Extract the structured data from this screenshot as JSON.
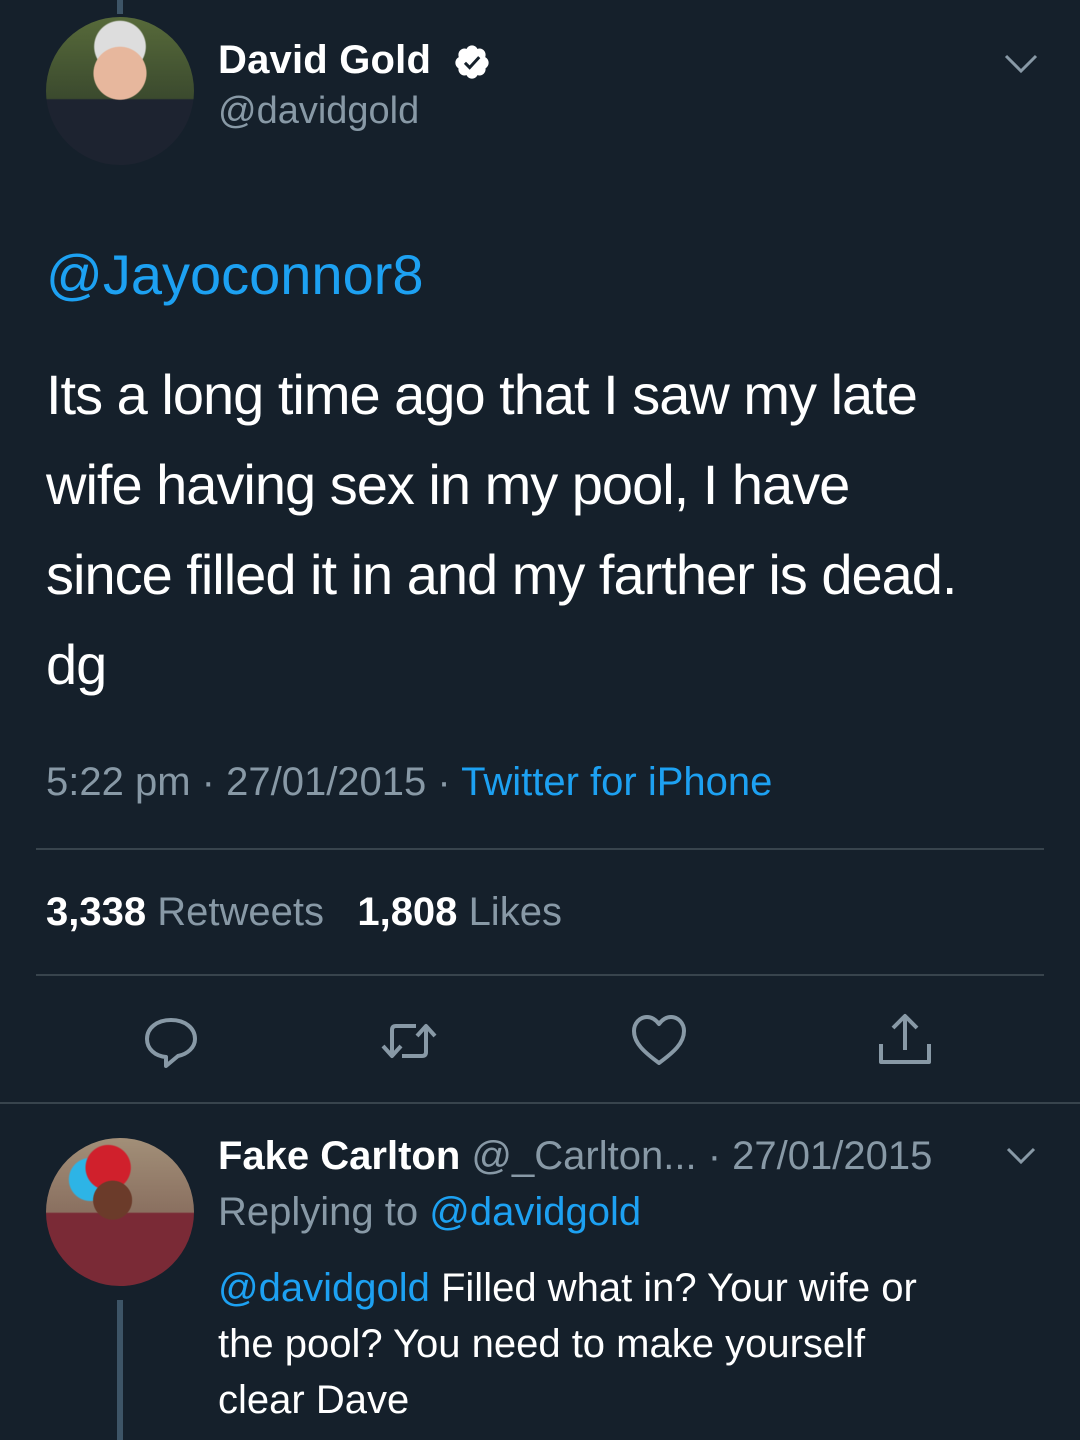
{
  "tweet": {
    "author_name": "David Gold",
    "author_handle": "@davidgold",
    "mention": "@Jayoconnor8",
    "text_lines": [
      "Its a long time ago that I saw my late",
      "wife having sex in my pool, I have",
      "since filled it in and my farther is dead.",
      "dg"
    ],
    "time": "5:22 pm",
    "date": "27/01/2015",
    "source": "Twitter for iPhone",
    "retweets_count": "3,338",
    "retweets_label": "Retweets",
    "likes_count": "1,808",
    "likes_label": "Likes"
  },
  "actions": [
    "reply-icon",
    "retweet-icon",
    "like-icon",
    "share-icon"
  ],
  "reply": {
    "author_name": "Fake Carlton",
    "author_handle": "@_Carlton...",
    "date": "· 27/01/2015",
    "replying_label": "Replying to",
    "replying_to": "@davidgold",
    "mention": "@davidgold",
    "text_lines": [
      "Filled what in? Your wife or",
      "the pool? You need to make yourself",
      "clear Dave"
    ]
  },
  "colors": {
    "background": "#15202b",
    "accent": "#1da1f2",
    "secondary_text": "#8899a6",
    "divider": "#38444d"
  }
}
